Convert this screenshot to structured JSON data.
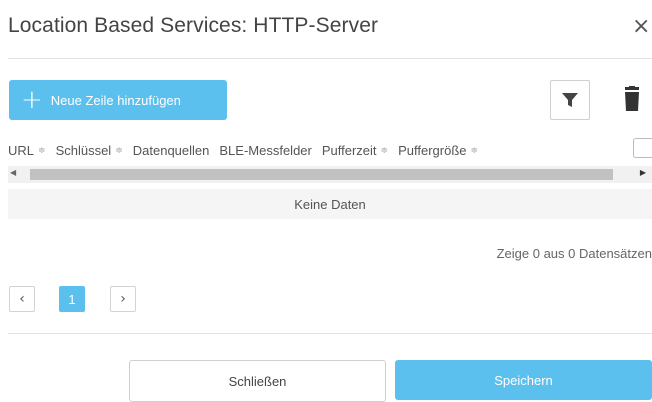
{
  "dialog": {
    "title": "Location Based Services: HTTP-Server",
    "close_glyph": "×"
  },
  "toolbar": {
    "add_label": "Neue Zeile hinzufügen",
    "add_icon": "plus-icon",
    "filter_icon": "filter-icon",
    "delete_icon": "trash-icon"
  },
  "table": {
    "columns": [
      {
        "label": "URL",
        "sortable": true
      },
      {
        "label": "Schlüssel",
        "sortable": true
      },
      {
        "label": "Datenquellen",
        "sortable": false
      },
      {
        "label": "BLE-Messfelder",
        "sortable": false
      },
      {
        "label": "Pufferzeit",
        "sortable": true
      },
      {
        "label": "Puffergröße",
        "sortable": true
      }
    ],
    "sort_glyph": "≑",
    "empty_text": "Keine Daten"
  },
  "pagination": {
    "summary": "Zeige 0 aus 0 Datensätzen",
    "current_page": "1",
    "prev_glyph": "‹",
    "next_glyph": "›"
  },
  "footer": {
    "close_label": "Schließen",
    "save_label": "Speichern"
  },
  "colors": {
    "accent": "#5bc0ee",
    "empty_row_bg": "#f5f5f5"
  }
}
